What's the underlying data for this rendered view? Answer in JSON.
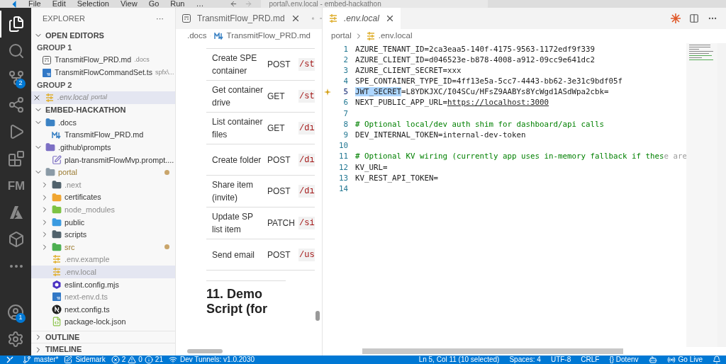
{
  "menu": [
    "File",
    "Edit",
    "Selection",
    "View",
    "Go",
    "Run",
    "…"
  ],
  "command_center": "portal\\.env.local - embed-hackathon",
  "activity_bar": [
    {
      "kind": "files",
      "selected": true
    },
    {
      "kind": "search",
      "selected": false
    },
    {
      "kind": "source-control",
      "selected": false,
      "badge": "2"
    },
    {
      "kind": "sharepoint",
      "selected": false
    },
    {
      "kind": "run",
      "selected": false
    },
    {
      "kind": "extensions",
      "selected": false
    },
    {
      "kind": "fm",
      "selected": false,
      "label": "FM"
    },
    {
      "kind": "azure",
      "selected": false
    },
    {
      "kind": "box",
      "selected": false
    },
    {
      "kind": "more",
      "selected": false
    }
  ],
  "activity_bottom": [
    {
      "kind": "account",
      "badge": "1"
    },
    {
      "kind": "settings"
    }
  ],
  "explorer": {
    "title": "EXPLORER",
    "more": "···",
    "open_editors": {
      "title": "OPEN EDITORS",
      "expanded": true,
      "groups": [
        {
          "title": "GROUP 1",
          "items": [
            {
              "name": "TransmitFlow_PRD.md",
              "detail": ".docs",
              "kind": "preview",
              "selected": false
            },
            {
              "name": "TransmitFlowCommandSet.ts",
              "detail": "spfx\\...",
              "kind": "ts",
              "selected": false
            }
          ]
        },
        {
          "title": "GROUP 2",
          "items": [
            {
              "name": ".env.local",
              "detail": "portal",
              "kind": "env",
              "selected": true
            }
          ]
        }
      ]
    },
    "workspace": {
      "title": "EMBED-HACKATHON",
      "expanded": true,
      "tree": [
        {
          "name": ".docs",
          "kind": "folder",
          "expanded": true,
          "modified": false,
          "selected": false,
          "children": [
            {
              "name": "TransmitFlow_PRD.md",
              "kind": "md",
              "selected": false
            }
          ]
        },
        {
          "name": ".github\\prompts",
          "kind": "folder",
          "expanded": true,
          "modified": false,
          "selected": false,
          "children": [
            {
              "name": "plan-transmitFlowMvp.prompt....",
              "kind": "prompt",
              "selected": false
            }
          ]
        },
        {
          "name": "portal",
          "kind": "folder",
          "expanded": true,
          "modified": true,
          "selected": false,
          "children": [
            {
              "name": ".next",
              "kind": "folder",
              "expanded": false,
              "modified": false,
              "selected": false,
              "ignored": true
            },
            {
              "name": "certificates",
              "kind": "folder",
              "expanded": false,
              "modified": false,
              "selected": false,
              "ignored": false
            },
            {
              "name": "node_modules",
              "kind": "folder",
              "expanded": false,
              "modified": false,
              "selected": false,
              "ignored": true
            },
            {
              "name": "public",
              "kind": "folder",
              "expanded": false,
              "modified": false,
              "selected": false,
              "ignored": false
            },
            {
              "name": "scripts",
              "kind": "folder",
              "expanded": false,
              "modified": false,
              "selected": false,
              "ignored": false
            },
            {
              "name": "src",
              "kind": "folder",
              "expanded": false,
              "modified": true,
              "selected": false,
              "ignored": false
            },
            {
              "name": ".env.example",
              "kind": "env",
              "selected": false,
              "ignored": true
            },
            {
              "name": ".env.local",
              "kind": "env",
              "selected": true,
              "ignored": true
            },
            {
              "name": "eslint.config.mjs",
              "kind": "eslint",
              "selected": false,
              "ignored": false
            },
            {
              "name": "next-env.d.ts",
              "kind": "ts",
              "selected": false,
              "ignored": true
            },
            {
              "name": "next.config.ts",
              "kind": "next",
              "selected": false,
              "ignored": false
            },
            {
              "name": "package-lock.json",
              "kind": "json",
              "selected": false,
              "ignored": false
            }
          ]
        }
      ]
    },
    "sections": [
      {
        "title": "OUTLINE",
        "expanded": false
      },
      {
        "title": "TIMELINE",
        "expanded": false
      }
    ]
  },
  "preview": {
    "tab": {
      "title": "TransmitFlow_PRD.md",
      "selected": false
    },
    "breadcrumb": [
      ".docs",
      "TransmitFlow_PRD.md"
    ],
    "rows": [
      {
        "operation": "Create SPE container",
        "method": "POST",
        "path": "/st"
      },
      {
        "operation": "Get container drive",
        "method": "GET",
        "path": "/st"
      },
      {
        "operation": "List container files",
        "method": "GET",
        "path": "/dı"
      },
      {
        "operation": "Create folder",
        "method": "POST",
        "path": "/dı"
      },
      {
        "operation": "Share item (invite)",
        "method": "POST",
        "path": "/dı"
      },
      {
        "operation": "Update SP list item",
        "method": "PATCH",
        "path": "/si"
      },
      {
        "operation": "Send email",
        "method": "POST",
        "path": "/us"
      }
    ],
    "heading": "11. Demo Script (for"
  },
  "editor": {
    "tab": {
      "title": ".env.local",
      "selected": true
    },
    "breadcrumb": [
      "portal",
      ".env.local"
    ],
    "lines": [
      {
        "n": "1",
        "current": false,
        "parts": [
          {
            "kind": "plain",
            "text": "AZURE_TENANT_ID=2ca3eaa5-140f-4175-9563-1172edf9f339"
          }
        ]
      },
      {
        "n": "2",
        "current": false,
        "parts": [
          {
            "kind": "plain",
            "text": "AZURE_CLIENT_ID=d046523e-b878-4008-a912-09cc9e641dc2"
          }
        ]
      },
      {
        "n": "3",
        "current": false,
        "parts": [
          {
            "kind": "plain",
            "text": "AZURE_CLIENT_SECRET=xxx"
          }
        ]
      },
      {
        "n": "4",
        "current": false,
        "parts": [
          {
            "kind": "plain",
            "text": "SPE_CONTAINER_TYPE_ID=4ff13e5a-5cc7-4443-bb62-3e31c9bdf05f"
          }
        ]
      },
      {
        "n": "5",
        "current": true,
        "parts": [
          {
            "kind": "selected",
            "text": "JWT_SECRET"
          },
          {
            "kind": "plain",
            "text": "=L8YDKJXC/I04SCu/HFsZ9AABYs8YcWgd1ASdWpa2cbk="
          }
        ]
      },
      {
        "n": "6",
        "current": false,
        "parts": [
          {
            "kind": "plain",
            "text": "NEXT_PUBLIC_APP_URL="
          },
          {
            "kind": "link",
            "text": "https://localhost:3000"
          }
        ]
      },
      {
        "n": "7",
        "current": false
      },
      {
        "n": "8",
        "current": false,
        "parts": [
          {
            "kind": "comment",
            "text": "# Optional local/dev auth shim for dashboard/api calls"
          }
        ]
      },
      {
        "n": "9",
        "current": false,
        "parts": [
          {
            "kind": "plain",
            "text": "DEV_INTERNAL_TOKEN=internal-dev-token"
          }
        ]
      },
      {
        "n": "10",
        "current": false
      },
      {
        "n": "11",
        "current": false,
        "parts": [
          {
            "kind": "comment",
            "text": "# Optional KV wiring (currently app uses in-memory fallback if thes"
          },
          {
            "kind": "faded",
            "text": "e are"
          }
        ]
      },
      {
        "n": "12",
        "current": false,
        "parts": [
          {
            "kind": "plain",
            "text": "KV_URL="
          }
        ]
      },
      {
        "n": "13",
        "current": false,
        "parts": [
          {
            "kind": "plain",
            "text": "KV_REST_API_TOKEN="
          }
        ]
      },
      {
        "n": "14",
        "current": false
      }
    ]
  },
  "status_bar": {
    "left": [
      {
        "kind": "remote"
      },
      {
        "kind": "branch",
        "text": "master*"
      },
      {
        "kind": "sidemark",
        "text": "Sidemark"
      },
      {
        "kind": "problems",
        "errors": "2",
        "warnings": "0",
        "infos": "21"
      },
      {
        "kind": "tunnel",
        "text": "Dev Tunnels: v1.0.2030"
      }
    ],
    "right": [
      {
        "kind": "text",
        "text": "Ln 5, Col 11 (10 selected)"
      },
      {
        "kind": "text",
        "text": "Spaces: 4"
      },
      {
        "kind": "text",
        "text": "UTF-8"
      },
      {
        "kind": "text",
        "text": "CRLF"
      },
      {
        "kind": "text",
        "text": "{} Dotenv"
      },
      {
        "kind": "copilot"
      },
      {
        "kind": "golive",
        "text": "Go Live"
      },
      {
        "kind": "bell"
      }
    ]
  }
}
